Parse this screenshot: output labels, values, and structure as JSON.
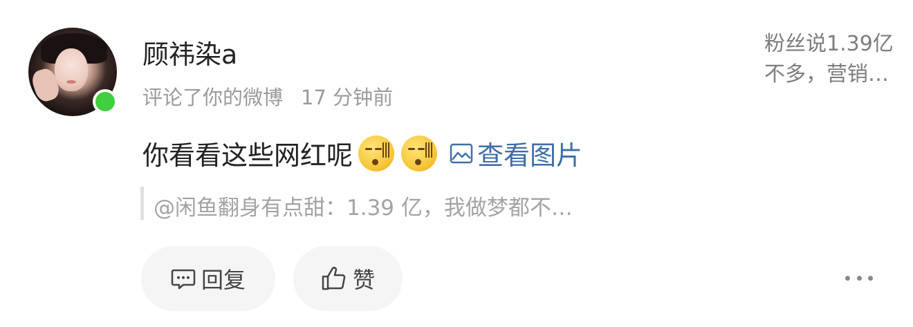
{
  "comment": {
    "username": "顾祎染a",
    "action": "评论了你的微博",
    "time": "17 分钟前",
    "text": "你看看这些网红呢",
    "view_image_label": "查看图片",
    "quote": "@闲鱼翻身有点甜：1.39 亿，我做梦都不…"
  },
  "side_preview": {
    "text": "粉丝说1.39亿不多，营销…"
  },
  "actions": {
    "reply_label": "回复",
    "like_label": "赞"
  },
  "icons": {
    "emoji": "sweat-emoji-icon",
    "view_image": "picture-icon",
    "reply": "comment-icon",
    "like": "thumbs-up-icon",
    "more": "more-dots-icon"
  },
  "colors": {
    "online": "#3fcf3f",
    "link": "#3f6ea8"
  }
}
